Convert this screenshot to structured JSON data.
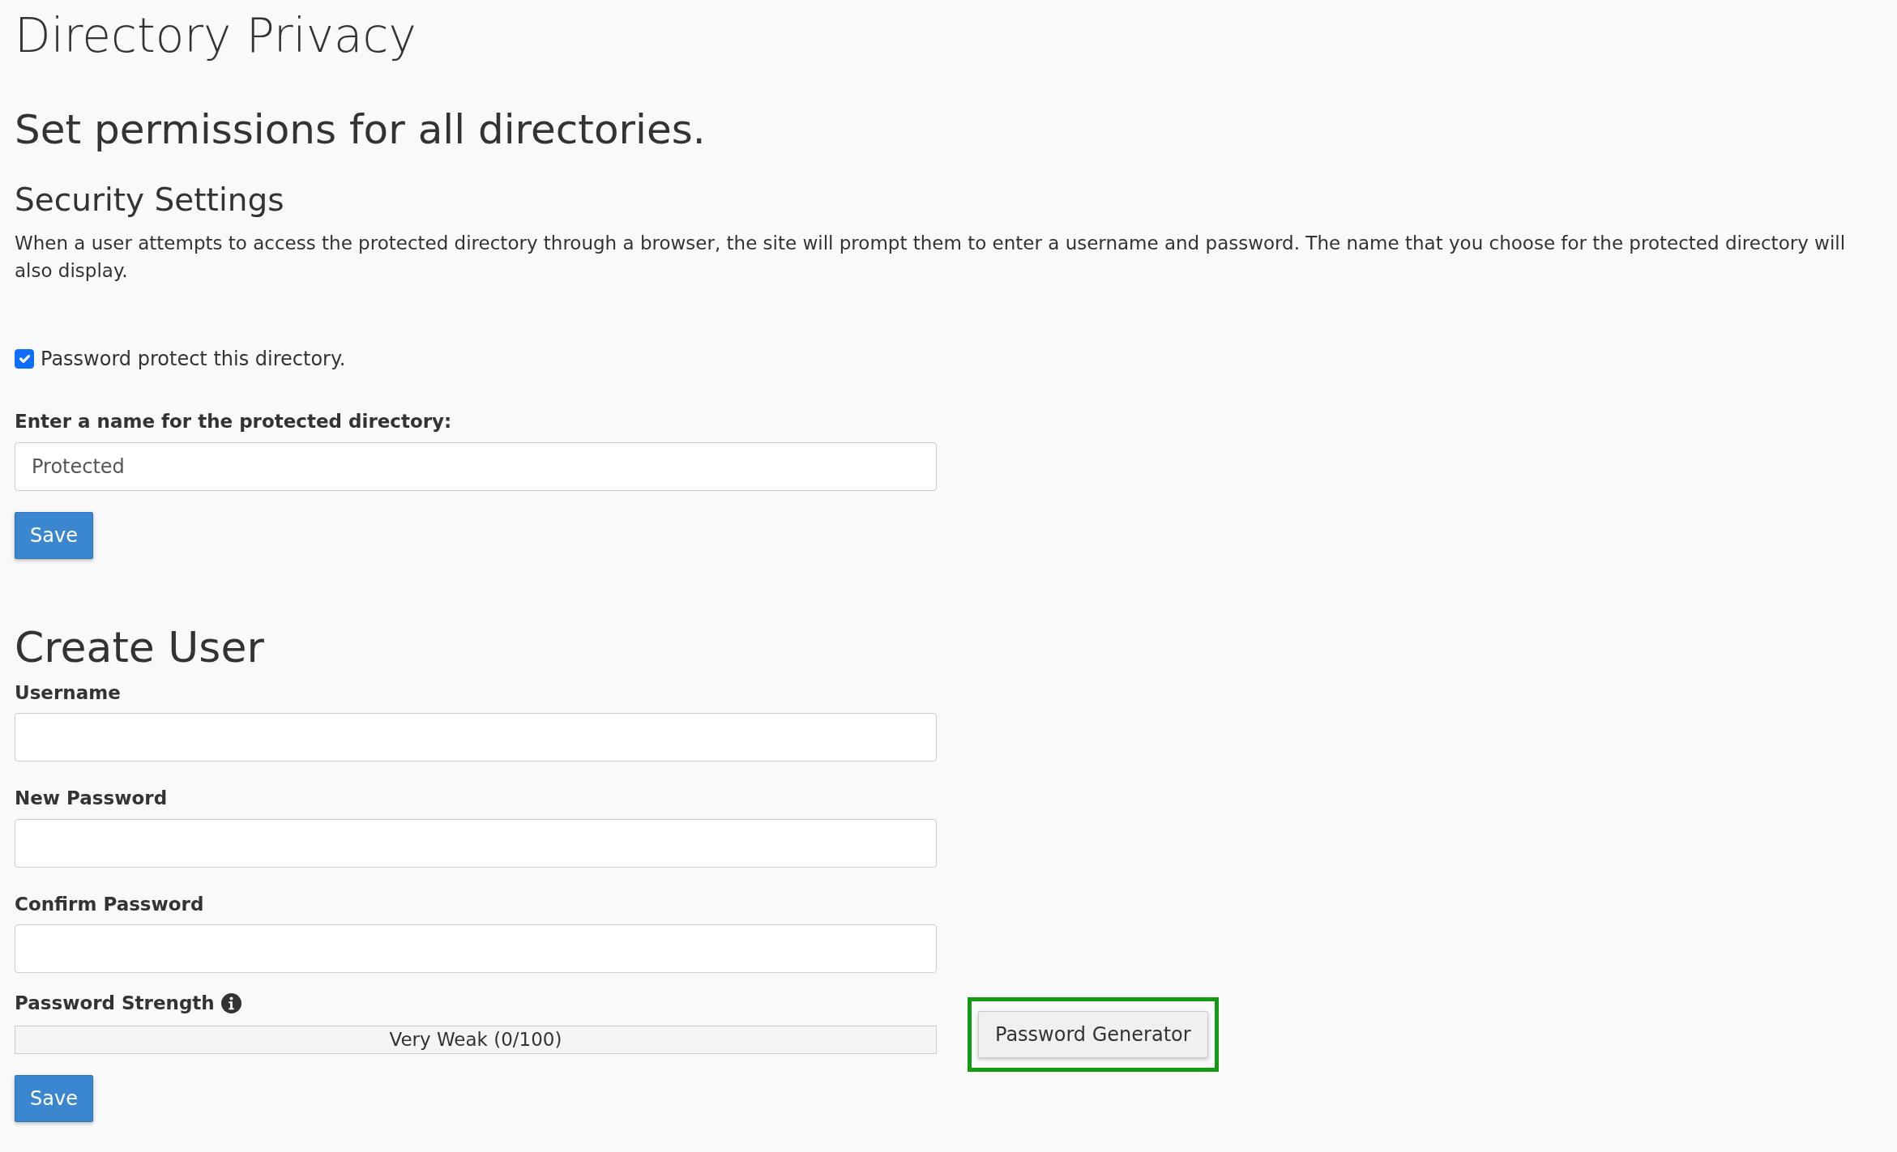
{
  "page_title": "Directory Privacy",
  "heading": "Set permissions for all directories.",
  "security": {
    "title": "Security Settings",
    "description": "When a user attempts to access the protected directory through a browser, the site will prompt them to enter a username and password. The name that you choose for the protected directory will also display.",
    "protect_checkbox": {
      "label": "Password protect this directory.",
      "checked": true
    },
    "name_field": {
      "label": "Enter a name for the protected directory:",
      "value": "Protected"
    },
    "save_button": "Save"
  },
  "create_user": {
    "title": "Create User",
    "fields": [
      {
        "label": "Username"
      },
      {
        "label": "New Password"
      },
      {
        "label": "Confirm Password"
      }
    ],
    "strength": {
      "label": "Password Strength",
      "level": 0,
      "reading": "Very Weak (0/100)"
    },
    "generator": {
      "label": "Password Generator",
      "highlighted": true
    },
    "save_button": "Save"
  }
}
